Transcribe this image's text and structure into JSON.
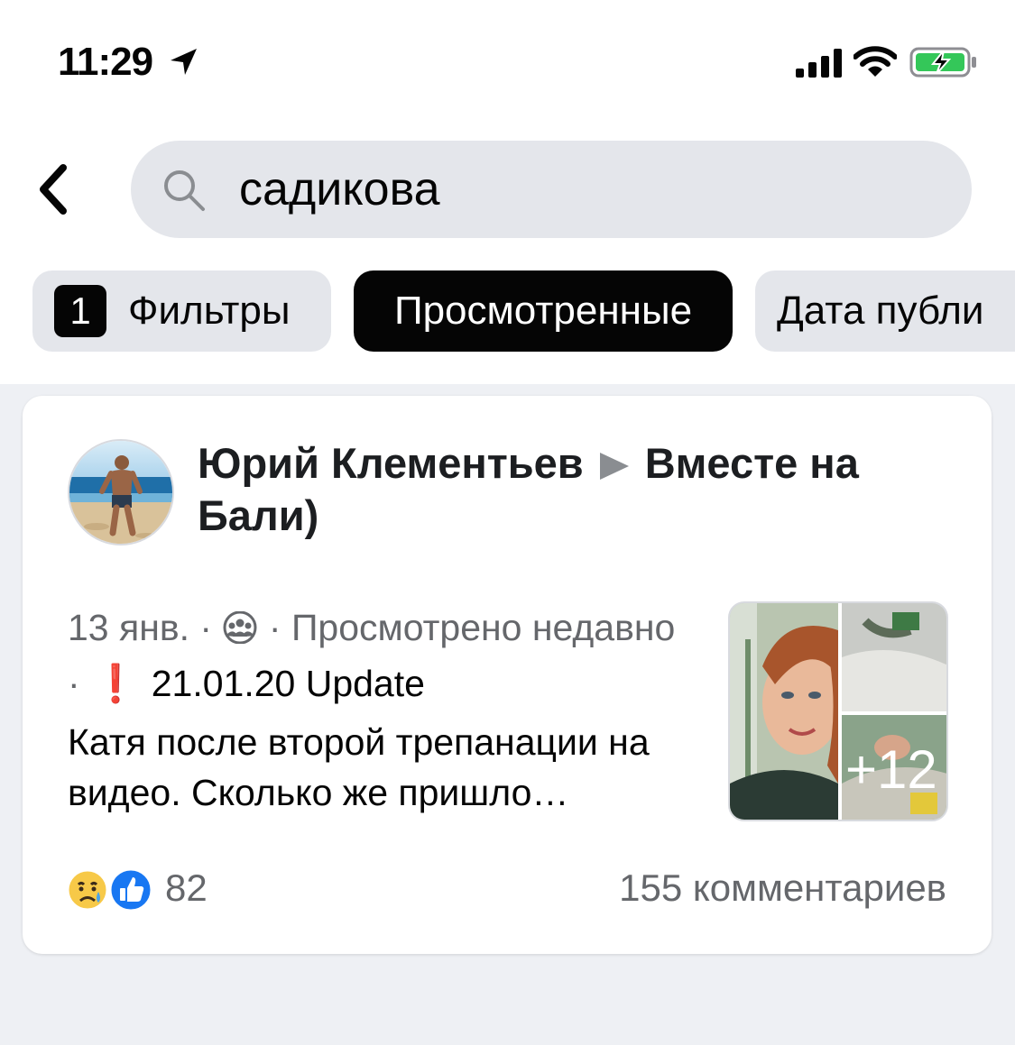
{
  "status_bar": {
    "time": "11:29"
  },
  "icons": {
    "location": "location-arrow-icon",
    "signal": "cellular-signal-icon",
    "wifi": "wifi-icon",
    "battery": "battery-charging-icon",
    "back": "chevron-left-icon",
    "search": "search-icon",
    "people": "friends-audience-icon",
    "sad": "sad-reaction-icon",
    "like": "like-reaction-icon"
  },
  "search": {
    "query": "садикова"
  },
  "filters": {
    "count": "1",
    "filters_label": "Фильтры",
    "viewed_label": "Просмотренные",
    "date_label": "Дата публи"
  },
  "post": {
    "author": "Юрий Клементьев",
    "group": "Вместе на Бали)",
    "date": "13 янв.",
    "dot": "·",
    "viewed": "Просмотрено недавно",
    "exclamation": "❗",
    "update": "21.01.20 Update",
    "text": "Катя после второй трепанации на видео. Сколько же пришло…",
    "more_photos": "+12",
    "reactions_count": "82",
    "comments": "155 комментариев"
  },
  "colors": {
    "background": "#eef0f4",
    "chip_gray": "#e4e6eb",
    "chip_active": "#050505",
    "secondary_text": "#65676b",
    "like_blue": "#1877f2",
    "battery_green": "#34c759"
  }
}
